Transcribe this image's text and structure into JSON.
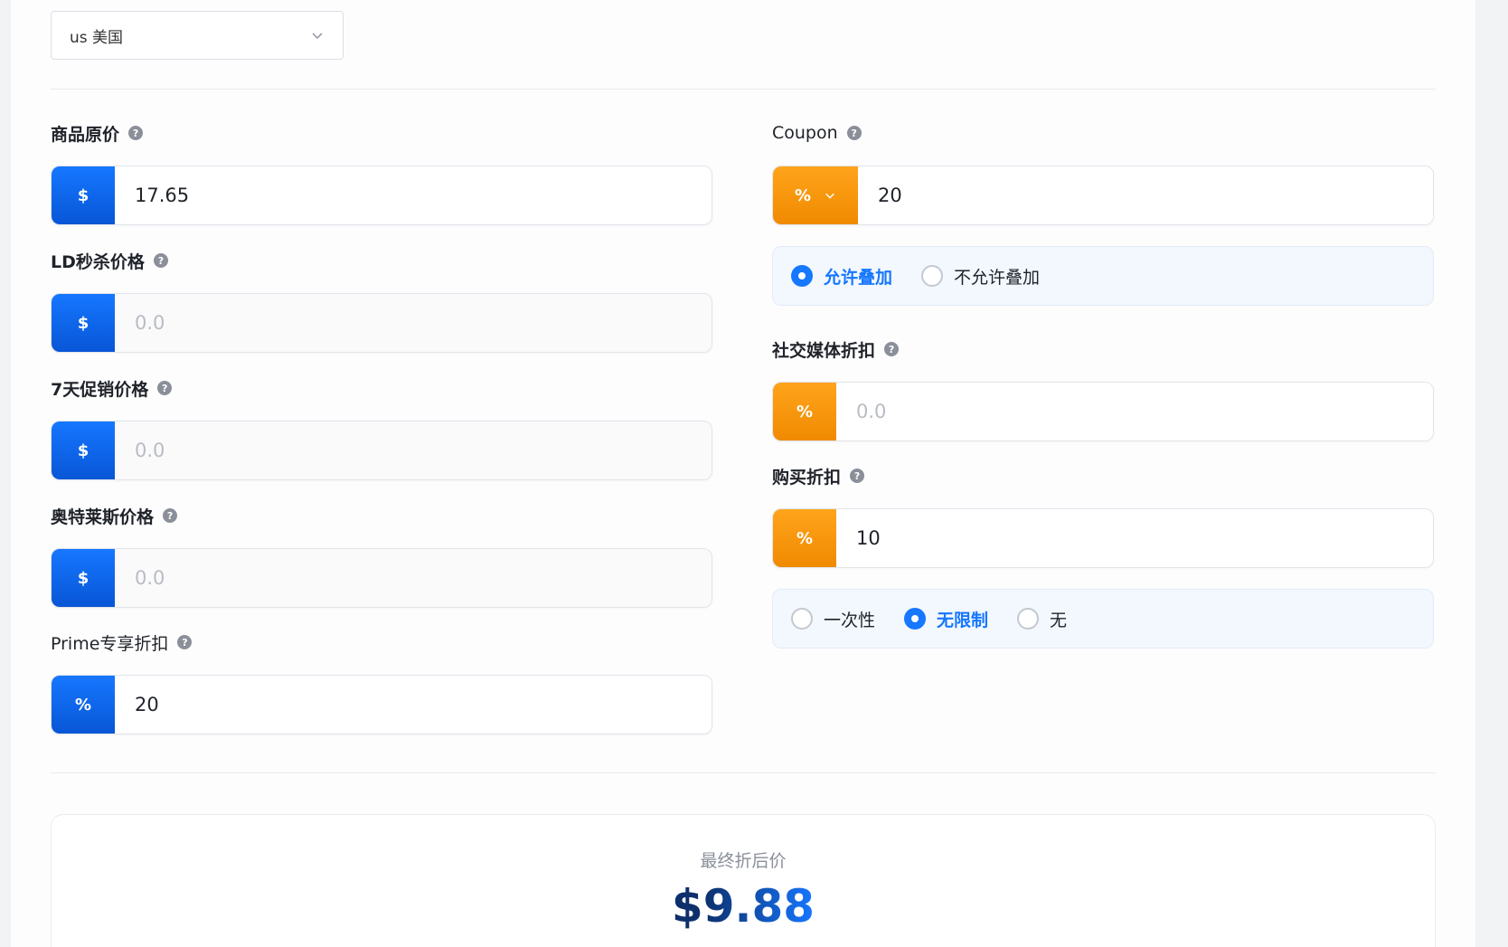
{
  "country": {
    "selected": "us 美国"
  },
  "left_fields": [
    {
      "label": "商品原价",
      "prefix": "$",
      "value": "17.65",
      "placeholder": "0.0"
    },
    {
      "label": "LD秒杀价格",
      "prefix": "$",
      "value": "",
      "placeholder": "0.0"
    },
    {
      "label": "7天促销价格",
      "prefix": "$",
      "value": "",
      "placeholder": "0.0"
    },
    {
      "label": "奥特莱斯价格",
      "prefix": "$",
      "value": "",
      "placeholder": "0.0"
    },
    {
      "label": "Prime专享折扣",
      "prefix": "%",
      "value": "20",
      "placeholder": "0.0"
    }
  ],
  "coupon": {
    "label": "Coupon",
    "prefix": "%",
    "value": "20",
    "placeholder": "0.0"
  },
  "stack_options": [
    {
      "label": "允许叠加",
      "selected": true
    },
    {
      "label": "不允许叠加",
      "selected": false
    }
  ],
  "social": {
    "label": "社交媒体折扣",
    "prefix": "%",
    "value": "",
    "placeholder": "0.0"
  },
  "purchase": {
    "label": "购买折扣",
    "prefix": "%",
    "value": "10",
    "placeholder": "0.0"
  },
  "usage_options": [
    {
      "label": "一次性",
      "selected": false
    },
    {
      "label": "无限制",
      "selected": true
    },
    {
      "label": "无",
      "selected": false
    }
  ],
  "help_icon": "?",
  "result": {
    "title": "最终折后价",
    "currency": "$",
    "amount": "9.88"
  },
  "colors": {
    "blue": "#1677ff",
    "orange": "#f59a0c",
    "navy": "#0d2f6b"
  }
}
